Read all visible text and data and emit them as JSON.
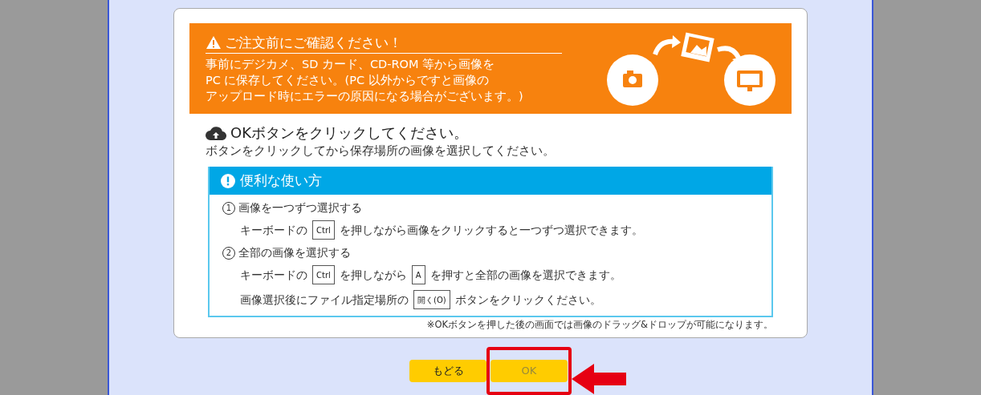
{
  "notice": {
    "title": "ご注文前にご確認ください！",
    "lines": [
      "事前にデジカメ、SD カード、CD-ROM 等から画像を",
      "PC に保存してください。(PC 以外からですと画像の",
      "アップロード時にエラーの原因になる場合がございます。)"
    ]
  },
  "instruction": {
    "title": "OKボタンをクリックしてください。",
    "subtitle": "ボタンをクリックしてから保存場所の画像を選択してください。"
  },
  "tips": {
    "title": "便利な使い方",
    "items": [
      {
        "number": "1",
        "heading": "画像を一つずつ選択する",
        "lines": [
          [
            {
              "text": "キーボードの"
            },
            {
              "key": "Ctrl"
            },
            {
              "text": "を押しながら画像をクリックすると一つずつ選択できます。"
            }
          ]
        ]
      },
      {
        "number": "2",
        "heading": "全部の画像を選択する",
        "lines": [
          [
            {
              "text": "キーボードの"
            },
            {
              "key": "Ctrl"
            },
            {
              "text": "を押しながら"
            },
            {
              "key": "A"
            },
            {
              "text": "を押すと全部の画像を選択できます。"
            }
          ],
          [
            {
              "text": "画像選択後にファイル指定場所の"
            },
            {
              "key": "開く(O)"
            },
            {
              "text": "ボタンをクリックください。"
            }
          ]
        ]
      }
    ]
  },
  "footnote": "※OKボタンを押した後の画面では画像のドラッグ&ドロップが可能になります。",
  "buttons": [
    {
      "label": "もどる",
      "highlighted": false
    },
    {
      "label": "OK",
      "highlighted": true
    }
  ]
}
